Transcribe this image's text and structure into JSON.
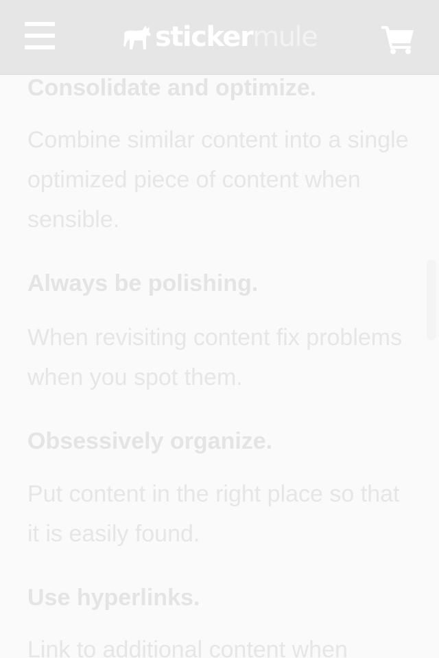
{
  "header": {
    "brand_primary": "sticker",
    "brand_secondary": "mule",
    "menu_icon": "hamburger-menu-icon",
    "cart_icon": "shopping-cart-icon",
    "logo_icon": "mule-silhouette-icon"
  },
  "sections": [
    {
      "heading": "Consolidate and optimize.",
      "body": "Combine similar content into a single optimized piece of content when sensible."
    },
    {
      "heading": "Always be polishing.",
      "body": "When revisiting content fix problems when you spot them."
    },
    {
      "heading": "Obsessively organize.",
      "body": "Put content in the right place so that it is easily found."
    },
    {
      "heading": "Use hyperlinks.",
      "body": "Link to additional content when"
    }
  ],
  "colors": {
    "header_bg": "#e6e6e6",
    "page_bg": "#fafafa",
    "text": "#e6e6e6"
  }
}
